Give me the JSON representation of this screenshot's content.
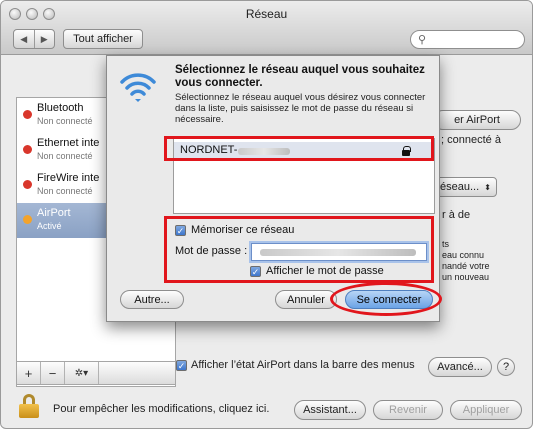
{
  "window": {
    "title": "Réseau"
  },
  "toolbar": {
    "show_all_label": "Tout afficher",
    "search_icon": "search-icon"
  },
  "sidebar": {
    "items": [
      {
        "label": "Bluetooth",
        "status": "Non connecté",
        "dot": "#d9362b"
      },
      {
        "label": "Ethernet inte",
        "status": "Non connecté",
        "dot": "#d9362b"
      },
      {
        "label": "FireWire inte",
        "status": "Non connecté",
        "dot": "#d9362b"
      },
      {
        "label": "AirPort",
        "status": "Activé",
        "dot": "#f3a32b"
      }
    ],
    "add_label": "+",
    "remove_label": "−",
    "gear_label": "✲▾"
  },
  "right_panel": {
    "airport_button": "er AirPort",
    "connected_text": "; connecté à",
    "network_select": "éseau...",
    "join_text": "r à de",
    "info_line1": "ts",
    "info_line2": "eau connu",
    "info_line3": "nandé votre",
    "info_line4": "un nouveau",
    "show_airport_status": "Afficher l’état AirPort dans la barre des menus",
    "advanced_button": "Avancé...",
    "help_label": "?"
  },
  "bottom": {
    "lock_text": "Pour empêcher les modifications, cliquez ici.",
    "assistant_button": "Assistant...",
    "revert_button": "Revenir",
    "apply_button": "Appliquer"
  },
  "dialog": {
    "title": "Sélectionnez le réseau auquel vous souhaitez vous connecter.",
    "description": "Sélectionnez le réseau auquel vous désirez vous connecter dans la liste, puis saisissez le mot de passe du réseau si nécessaire.",
    "network_name": "NORDNET-",
    "remember_label": "Mémoriser ce réseau",
    "password_label": "Mot de passe :",
    "show_password_label": "Afficher le mot de passe",
    "other_button": "Autre...",
    "cancel_button": "Annuler",
    "connect_button": "Se connecter"
  },
  "colors": {
    "highlight": "#e1161c",
    "accent": "#6ba3e6"
  }
}
